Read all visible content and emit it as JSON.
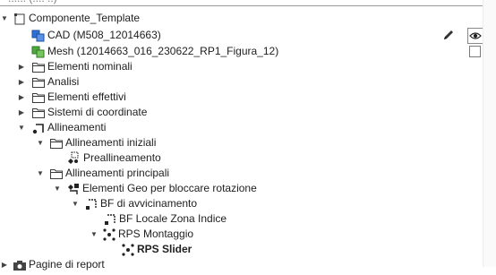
{
  "top_field": {
    "cut_text": "...... (.... ..)"
  },
  "tree": {
    "root": "Componente_Template",
    "cad": "CAD (M508_12014663)",
    "mesh": "Mesh (12014663_016_230622_RP1_Figura_12)",
    "nominal": "Elementi nominali",
    "analysis": "Analisi",
    "actual": "Elementi effettivi",
    "coord": "Sistemi di coordinate",
    "alignments": "Allineamenti",
    "initial": "Allineamenti iniziali",
    "prealign": "Preallineamento",
    "main": "Allineamenti principali",
    "geo": "Elementi Geo per bloccare rotazione",
    "bf_approach": "BF di avvicinamento",
    "bf_local": "BF Locale Zona Indice",
    "rps_mount": "RPS Montaggio",
    "rps_slider": "RPS Slider",
    "report": "Pagine di report"
  },
  "icons": {
    "cad": "cad-model-icon",
    "mesh": "mesh-icon",
    "folder": "folder-icon",
    "edit": "pencil-icon",
    "visibility": "eye-icon"
  },
  "colors": {
    "cad_blue": "#2f6fd6",
    "mesh_green": "#4fa83d",
    "folder_stroke": "#3b3b3b",
    "selection": "#e5f1fb"
  }
}
